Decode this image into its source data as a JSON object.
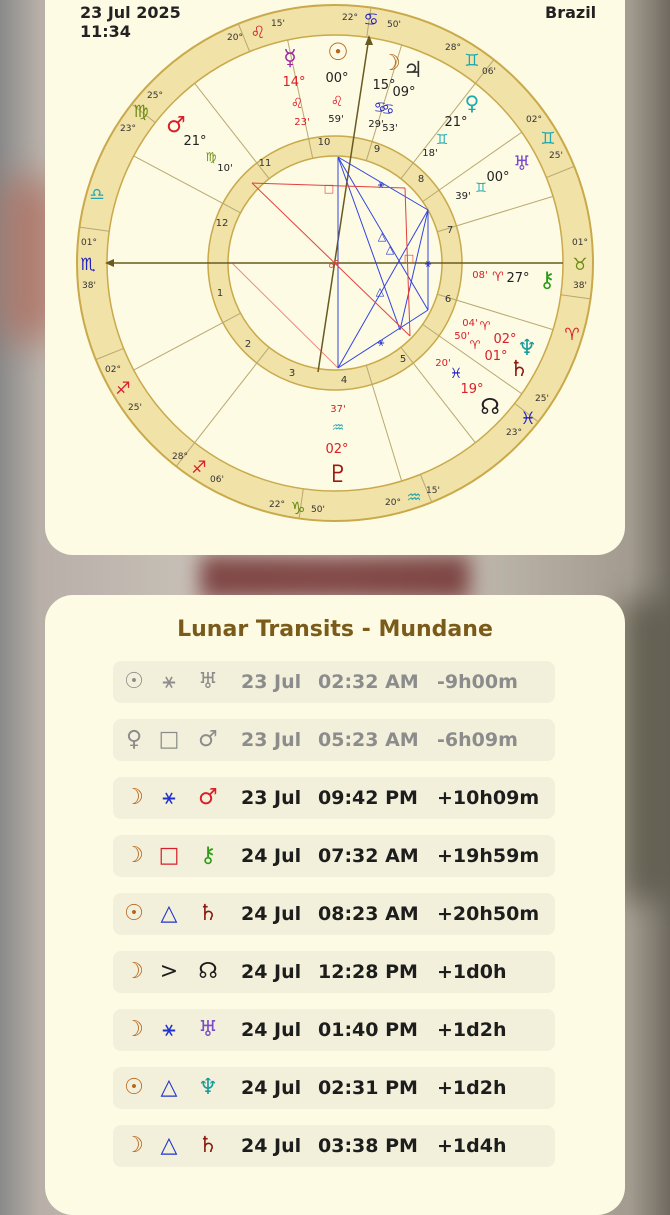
{
  "header": {
    "date": "23 Jul 2025",
    "time": "11:34",
    "place": "Brazil"
  },
  "colors": {
    "card_bg": "#fdfbe4",
    "ring": "#f1e2a8",
    "title": "#7a5b1a",
    "fire": "#d8202a",
    "water": "#2020c0",
    "air": "#20a8b0",
    "earth": "#6a8a10"
  },
  "chart": {
    "ring_labels": {
      "mc": [
        "22°",
        "♋",
        "50'"
      ],
      "asc": [
        "01°",
        "♏",
        "38'"
      ],
      "desc": [
        "01°",
        "♉",
        "38'"
      ],
      "ic": [
        "22°",
        "♑",
        "50'"
      ],
      "leo": [
        "20°",
        "♌",
        "15'"
      ],
      "virgo": [
        "25°",
        "♍",
        "23°"
      ],
      "libra": [
        "♎"
      ],
      "gem1": [
        "28°",
        "♊",
        "06'"
      ],
      "gem2": [
        "02°",
        "♊",
        "25'"
      ],
      "aries": [
        "♈"
      ],
      "pisces": [
        "25'",
        "♓",
        "23°"
      ],
      "aquarius": [
        "20°",
        "♒",
        "15'"
      ],
      "sag1": [
        "02°",
        "♐",
        "25'"
      ],
      "sag2": [
        "28°",
        "♐",
        "06'"
      ]
    },
    "planets": {
      "mercury": [
        "☿",
        "14°",
        "♌",
        "23'"
      ],
      "sun": [
        "☉",
        "00°",
        "♌",
        "59'"
      ],
      "moon": [
        "☽",
        "15°",
        "♋",
        "29'"
      ],
      "jupiter": [
        "♃",
        "09°",
        "♋",
        "53'"
      ],
      "venus": [
        "♀",
        "21°",
        "♊",
        "18'"
      ],
      "uranus": [
        "♅",
        "00°",
        "♊",
        "39'"
      ],
      "mars": [
        "♂",
        "21°",
        "♍",
        "10'"
      ],
      "chiron": [
        "⚷",
        "27°",
        "♈",
        "08'"
      ],
      "neptune": [
        "♆",
        "02°",
        "♈",
        "04'"
      ],
      "saturn": [
        "♄",
        "01°",
        "♈",
        "50'"
      ],
      "node": [
        "☊",
        "19°",
        "♓",
        "20'"
      ],
      "pluto": [
        "♇",
        "02°",
        "♒",
        "37'"
      ]
    },
    "houses": [
      "1",
      "2",
      "3",
      "4",
      "5",
      "6",
      "7",
      "8",
      "9",
      "10",
      "11",
      "12"
    ]
  },
  "transits": {
    "title": "Lunar Transits - Mundane",
    "rows": [
      {
        "p1": "☉",
        "asp": "⚹",
        "p2": "♅",
        "date": "23 Jul",
        "time": "02:32 AM",
        "delta": "-9h00m",
        "past": true,
        "c1": "#8c8c8c",
        "ca": "#8c8c8c",
        "c2": "#8c8c8c"
      },
      {
        "p1": "♀",
        "asp": "□",
        "p2": "♂",
        "date": "23 Jul",
        "time": "05:23 AM",
        "delta": "-6h09m",
        "past": true,
        "c1": "#8c8c8c",
        "ca": "#8c8c8c",
        "c2": "#8c8c8c"
      },
      {
        "p1": "☽",
        "asp": "⚹",
        "p2": "♂",
        "date": "23 Jul",
        "time": "09:42 PM",
        "delta": "+10h09m",
        "past": false,
        "c1": "#b5651d",
        "ca": "#2233cc",
        "c2": "#d8202a"
      },
      {
        "p1": "☽",
        "asp": "□",
        "p2": "⚷",
        "date": "24 Jul",
        "time": "07:32 AM",
        "delta": "+19h59m",
        "past": false,
        "c1": "#b5651d",
        "ca": "#d8202a",
        "c2": "#2f9a1a"
      },
      {
        "p1": "☉",
        "asp": "△",
        "p2": "♄",
        "date": "24 Jul",
        "time": "08:23 AM",
        "delta": "+20h50m",
        "past": false,
        "c1": "#b5651d",
        "ca": "#2233cc",
        "c2": "#8a1a10"
      },
      {
        "p1": "☽",
        "asp": ">",
        "p2": "☊",
        "date": "24 Jul",
        "time": "12:28 PM",
        "delta": "+1d0h",
        "past": false,
        "c1": "#b5651d",
        "ca": "#1d1d1d",
        "c2": "#1d1d1d"
      },
      {
        "p1": "☽",
        "asp": "⚹",
        "p2": "♅",
        "date": "24 Jul",
        "time": "01:40 PM",
        "delta": "+1d2h",
        "past": false,
        "c1": "#b5651d",
        "ca": "#2233cc",
        "c2": "#7a4cc8"
      },
      {
        "p1": "☉",
        "asp": "△",
        "p2": "♆",
        "date": "24 Jul",
        "time": "02:31 PM",
        "delta": "+1d2h",
        "past": false,
        "c1": "#b5651d",
        "ca": "#2233cc",
        "c2": "#1a9a9a"
      },
      {
        "p1": "☽",
        "asp": "△",
        "p2": "♄",
        "date": "24 Jul",
        "time": "03:38 PM",
        "delta": "+1d4h",
        "past": false,
        "c1": "#b5651d",
        "ca": "#2233cc",
        "c2": "#8a1a10"
      }
    ]
  }
}
